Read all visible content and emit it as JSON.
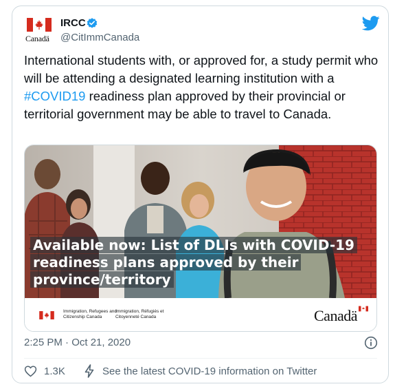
{
  "tweet": {
    "author_name": "IRCC",
    "author_handle": "@CitImmCanada",
    "logo_wordmark": "Canadä",
    "text_before": "International students with, or approved for, a study permit who will be attending a designated learning institution with a ",
    "hashtag": "#COVID19",
    "text_after": " readiness plan approved by their provincial or territorial government may be able to travel to Canada.",
    "timestamp": "2:25 PM · Oct 21, 2020",
    "like_count": "1.3K",
    "covid_link": "See the latest COVID-19 information on Twitter"
  },
  "media": {
    "overlay_lines": [
      "Available now: List of DLIs with COVID-19",
      "readiness plans approved by their",
      "province/territory"
    ],
    "dept_en": "Immigration, Refugees and Citizenship Canada",
    "dept_fr": "Immigration, Réfugiés et Citoyenneté Canada",
    "wordmark": "Canadä"
  },
  "icons": {
    "verified": "verified-badge-icon",
    "twitter": "twitter-bird-icon",
    "info": "info-icon",
    "like": "heart-icon",
    "covid": "lightning-bolt-icon"
  },
  "colors": {
    "accent": "#1d9bf0",
    "text": "#0f1419",
    "muted": "#536471",
    "flag_red": "#d52b1e"
  }
}
